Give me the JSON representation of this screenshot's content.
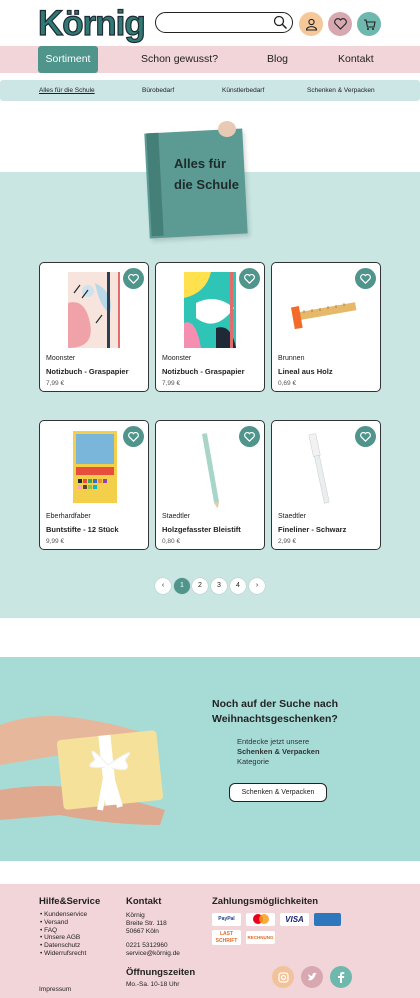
{
  "header": {
    "logo": "Körnig",
    "search_placeholder": "",
    "icons": [
      "search-icon",
      "user-icon",
      "heart-icon",
      "cart-icon"
    ]
  },
  "nav": {
    "items": [
      "Sortiment",
      "Schon gewusst?",
      "Blog",
      "Kontakt"
    ]
  },
  "subnav": {
    "items": [
      "Alles für die Schule",
      "Bürobedarf",
      "Künstlerbedarf",
      "Schenken & Verpacken"
    ]
  },
  "hero": {
    "title_line1": "Alles für",
    "title_line2": "die Schule"
  },
  "products": [
    {
      "brand": "Moonster",
      "name": "Notizbuch - Graspapier",
      "price": "7,99 €"
    },
    {
      "brand": "Moonster",
      "name": "Notizbuch - Graspapier",
      "price": "7,99 €"
    },
    {
      "brand": "Brunnen",
      "name": "Lineal aus Holz",
      "price": "0,69 €"
    },
    {
      "brand": "Eberhardfaber",
      "name": "Buntstifte - 12 Stück",
      "price": "9,99 €"
    },
    {
      "brand": "Staedtler",
      "name": "Holzgefasster Bleistift",
      "price": "0,80 €"
    },
    {
      "brand": "Staedtler",
      "name": "Fineliner - Schwarz",
      "price": "2,99 €"
    }
  ],
  "pagination": {
    "pages": [
      "1",
      "2",
      "3",
      "4"
    ],
    "active": "1",
    "prev": "‹",
    "next": "›"
  },
  "promo": {
    "heading_line1": "Noch auf der Suche nach",
    "heading_line2": "Weihnachtsgeschenken?",
    "text_line1": "Entdecke jetzt unsere",
    "text_line2": "Schenken & Verpacken",
    "text_line3": "Kategorie",
    "button": "Schenken & Verpacken"
  },
  "footer": {
    "service_title": "Hilfe&Service",
    "service_links": [
      "Kundenservice",
      "Versand",
      "FAQ",
      "Unsere AGB",
      "Datenschutz",
      "Widerrufsrecht"
    ],
    "impressum": "Impressum",
    "contact_title": "Kontakt",
    "contact_lines": [
      "Körnig",
      "Breite Str. 118",
      "50667 Köln"
    ],
    "phone": "0221 5312960",
    "email": "service@körnig.de",
    "hours_title": "Öffnungszeiten",
    "hours": "Mo.-Sa. 10-18 Uhr",
    "payment_title": "Zahlungsmöglichkeiten",
    "payment_methods": [
      "PayPal",
      "Mastercard",
      "VISA",
      "American Express",
      "LAST SCHRIFT",
      "RECHNUNG"
    ],
    "social": [
      "instagram-icon",
      "twitter-icon",
      "facebook-icon"
    ]
  },
  "colors": {
    "teal": "#4f958c",
    "light_teal": "#c9e6e3",
    "pink": "#f1d5d8",
    "promo": "#a7dbd6"
  }
}
